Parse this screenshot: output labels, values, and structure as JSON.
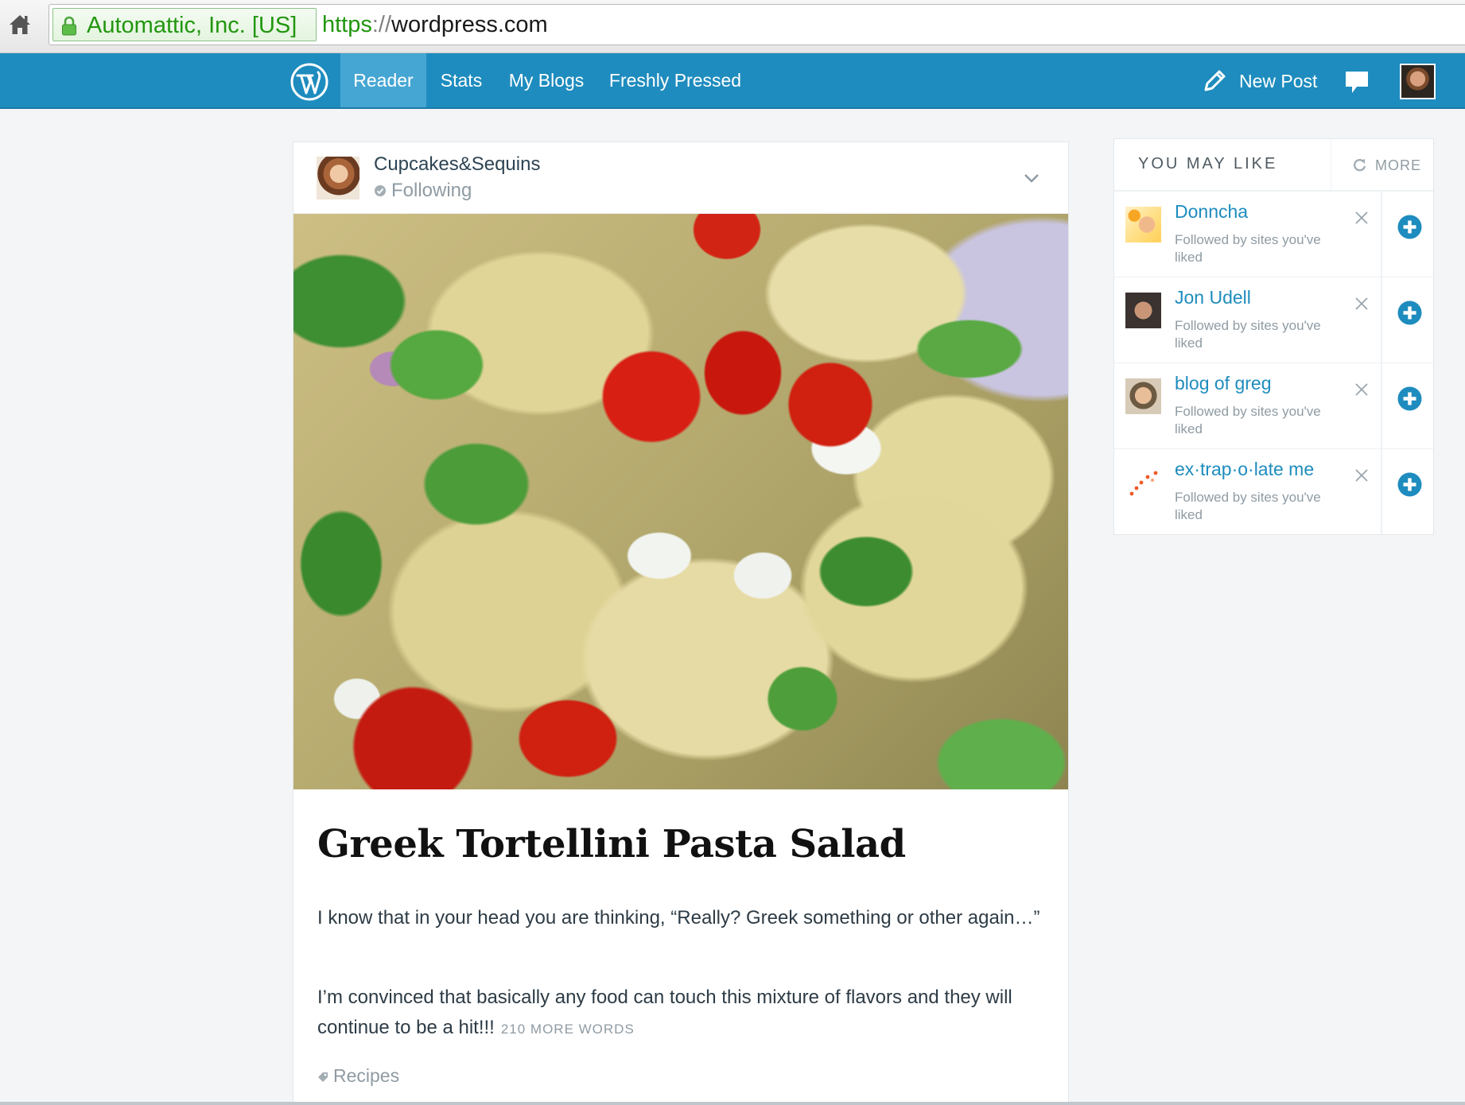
{
  "browser": {
    "ev_name": "Automattic, Inc. [US]",
    "url_scheme": "https",
    "url_sep": "://",
    "url_host": "wordpress.com"
  },
  "masterbar": {
    "nav": [
      "Reader",
      "Stats",
      "My Blogs",
      "Freshly Pressed"
    ],
    "active_nav": "Reader",
    "new_post": "New Post",
    "brand_color": "#1e8cbe",
    "active_color": "#46a6d3"
  },
  "post": {
    "blog_name": "Cupcakes&Sequins",
    "follow_status": "Following",
    "title": "Greek Tortellini Pasta Salad",
    "paragraph1": "I know that in your head you are thinking, “Really? Greek something or other again…”",
    "paragraph2": "I’m convinced that basically any food can touch this mixture of flavors and they will continue to be a hit!!!",
    "more_words": "210 MORE WORDS",
    "tag": "Recipes"
  },
  "sidebar": {
    "title": "YOU MAY LIKE",
    "more": "MORE",
    "recommendations": [
      {
        "name": "Donncha",
        "reason": "Followed by sites you've liked"
      },
      {
        "name": "Jon Udell",
        "reason": "Followed by sites you've liked"
      },
      {
        "name": "blog of greg",
        "reason": "Followed by sites you've liked"
      },
      {
        "name": "ex·trap·o·late me",
        "reason": "Followed by sites you've liked"
      }
    ]
  }
}
